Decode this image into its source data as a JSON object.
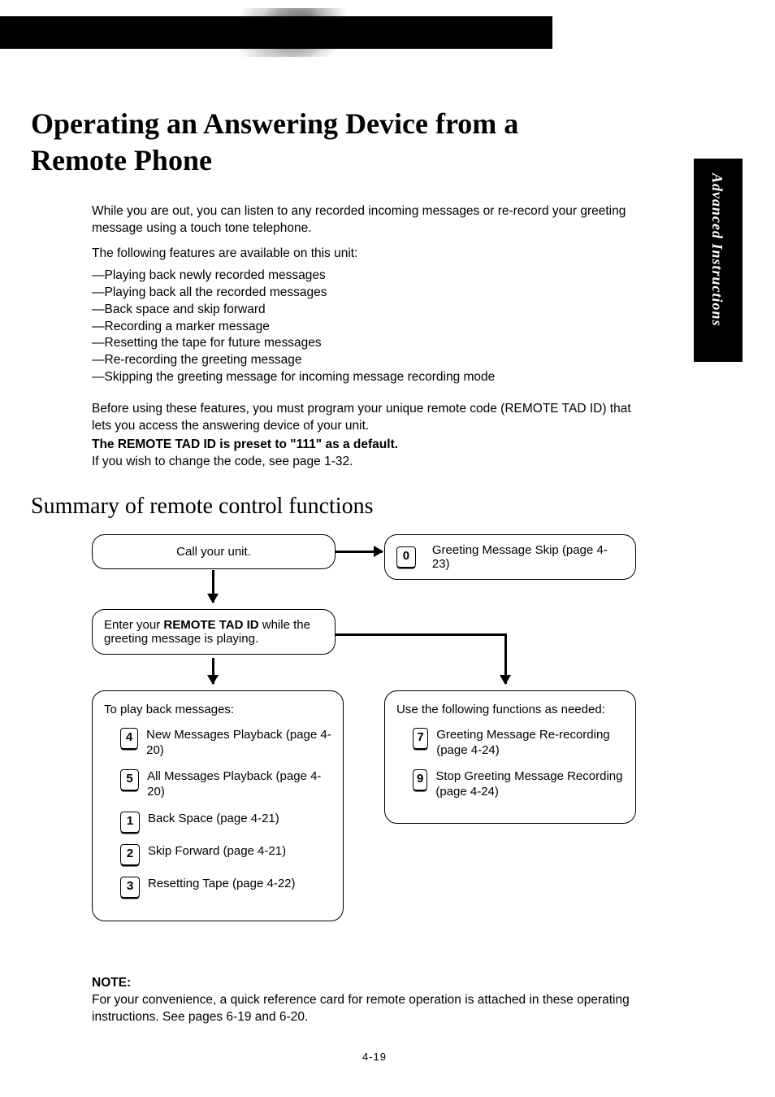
{
  "sideTab": "Advanced Instructions",
  "title": "Operating an Answering Device from a Remote Phone",
  "intro": "While you are out, you can listen to any recorded incoming messages or re-record your greeting message using a touch tone telephone.",
  "featuresLead": "The following features are available on this unit:",
  "features": [
    "Playing back newly recorded messages",
    "Playing back all the recorded messages",
    "Back space and skip forward",
    "Recording a marker message",
    "Resetting the tape for future messages",
    "Re-recording the greeting message",
    "Skipping the greeting message for incoming message recording mode"
  ],
  "before1": "Before using these features, you must program your unique remote code (REMOTE TAD ID) that lets you access the answering device of your unit.",
  "before2": "The REMOTE TAD ID is preset to \"111\" as a default.",
  "before3": "If you wish to change the code, see page 1-32.",
  "subheading": "Summary of remote control functions",
  "diagram": {
    "call": "Call your unit.",
    "skip": {
      "key": "0",
      "label": "Greeting Message Skip (page 4-23)"
    },
    "enter_pre": "Enter your ",
    "enter_bold": "REMOTE TAD ID",
    "enter_post": " while the greeting message is playing.",
    "playHeader": "To play back messages:",
    "playItems": [
      {
        "key": "4",
        "label": "New Messages Playback (page 4-20)"
      },
      {
        "key": "5",
        "label": "All Messages Playback (page 4-20)"
      },
      {
        "key": "1",
        "label": "Back Space (page 4-21)"
      },
      {
        "key": "2",
        "label": "Skip Forward (page 4-21)"
      },
      {
        "key": "3",
        "label": "Resetting Tape (page 4-22)"
      }
    ],
    "useHeader": "Use the following functions as needed:",
    "useItems": [
      {
        "key": "7",
        "label": "Greeting Message Re‑recording (page 4-24)"
      },
      {
        "key": "9",
        "label": "Stop Greeting Message Recording (page 4-24)"
      }
    ]
  },
  "noteLabel": "NOTE:",
  "noteText": "For your convenience, a quick reference card for remote operation is attached in these operating instructions. See pages 6-19 and 6-20.",
  "pageNumber": "4-19"
}
